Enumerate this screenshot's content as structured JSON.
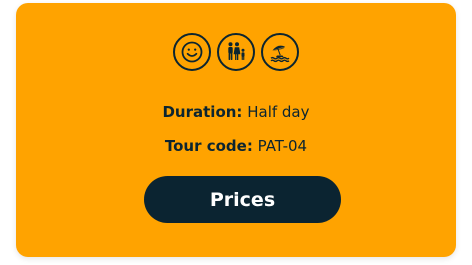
{
  "icons": [
    {
      "name": "smiley-face-icon"
    },
    {
      "name": "family-icon"
    },
    {
      "name": "beach-umbrella-icon"
    }
  ],
  "details": {
    "duration_label": "Duration:",
    "duration_value": "Half day",
    "tour_code_label": "Tour code:",
    "tour_code_value": "PAT-04"
  },
  "button": {
    "prices_label": "Prices"
  },
  "colors": {
    "card_background": "#ffa300",
    "dark_navy": "#0b2431",
    "button_text": "#ffffff"
  }
}
